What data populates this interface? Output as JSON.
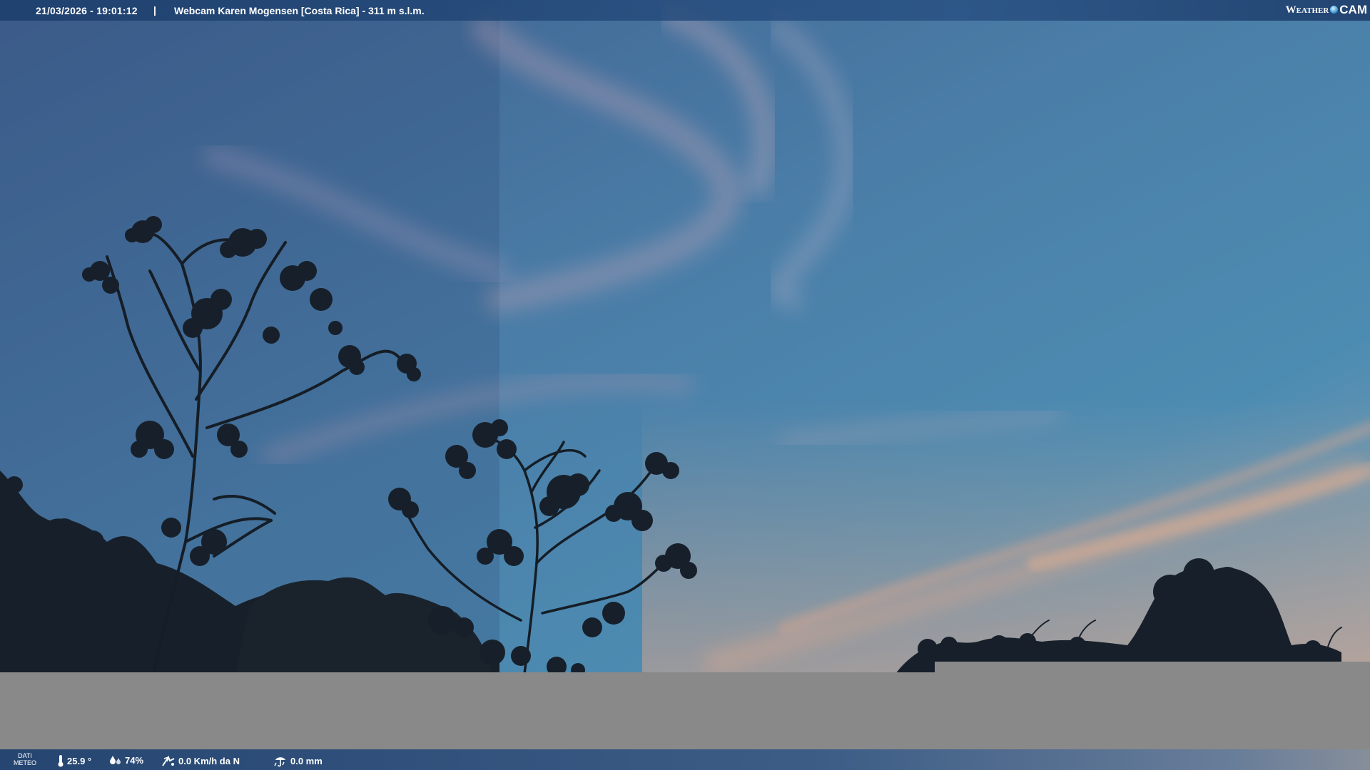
{
  "header": {
    "datetime": "21/03/2026 - 19:01:12",
    "separator": "|",
    "title": "Webcam Karen Mogensen [Costa Rica]  - 311 m s.l.m.",
    "logo": {
      "word1": "Weather",
      "word2": "CAM"
    }
  },
  "weather": {
    "section_label_line1": "DATI",
    "section_label_line2": "METEO",
    "temperature": "25.9 °",
    "humidity": "74%",
    "wind": "0.0 Km/h da N",
    "rain": "0.0 mm"
  },
  "icons": [
    "thermometer-icon",
    "humidity-icon",
    "wind-icon",
    "rain-icon"
  ],
  "colors": {
    "sky_top": "#4a6a96",
    "sky_mid": "#4a82ab",
    "sunset_glow": "#d8a88a",
    "blank_panel": "#8a8a8a"
  }
}
